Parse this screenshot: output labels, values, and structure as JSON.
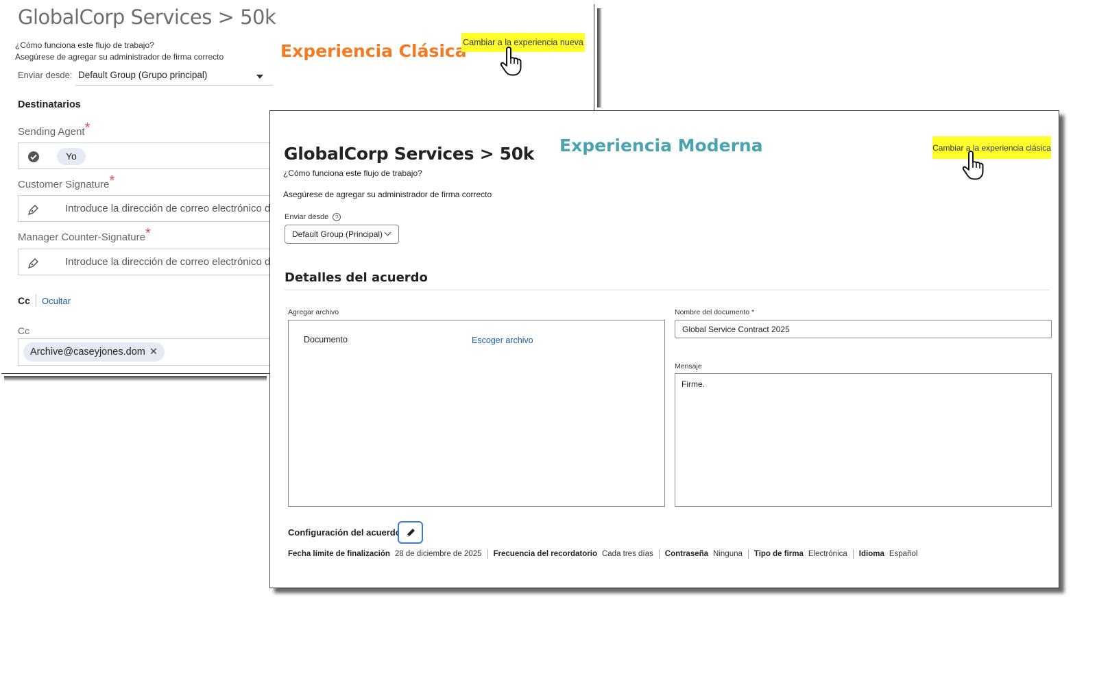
{
  "classic": {
    "title": "GlobalCorp Services > 50k",
    "how_it_works": "¿Cómo funciona este flujo de trabajo?",
    "ensure_admin": "Asegúrese de agregar su administrador de firma correcto",
    "experience_label": "Experiencia Clásica",
    "switch_button": "Cambiar a la experiencia nueva",
    "send_from_label": "Enviar desde:",
    "send_from_value": "Default Group (Grupo principal)",
    "recipients_heading": "Destinatarios",
    "recipients": [
      {
        "label": "Sending Agent",
        "required": "*",
        "value": "Yo"
      },
      {
        "label": "Customer Signature",
        "required": "*",
        "placeholder": "Introduce la dirección de correo electrónico de"
      },
      {
        "label": "Manager Counter-Signature",
        "required": "*",
        "placeholder": "Introduce la dirección de correo electrónico de"
      }
    ],
    "cc_label": "Cc",
    "hide_link": "Ocultar",
    "cc_field_label": "Cc",
    "cc_chip": "Archive@caseyjones.dom",
    "cc_chip_remove": "✕"
  },
  "modern": {
    "title": "GlobalCorp Services > 50k",
    "experience_label": "Experiencia Moderna",
    "switch_button": "Cambiar a la experiencia clásica",
    "how_it_works": "¿Cómo funciona este flujo de trabajo?",
    "ensure_admin": "Asegúrese de agregar su administrador de firma correcto",
    "send_from_label": "Enviar desde",
    "help_glyph": "?",
    "send_from_value": "Default Group (Principal)",
    "section_title": "Detalles del acuerdo",
    "add_file_label": "Agregar archivo",
    "document_label": "Documento",
    "choose_file": "Escoger archivo",
    "doc_name_label": "Nombre del documento",
    "doc_name_required": "*",
    "doc_name_value": "Global Service Contract 2025",
    "message_label": "Mensaje",
    "message_value": "Firme.",
    "config_label": "Configuración del acuerdo",
    "summary": [
      {
        "key": "Fecha límite de finalización",
        "value": "28 de diciembre de 2025"
      },
      {
        "key": "Frecuencia del recordatorio",
        "value": "Cada tres días"
      },
      {
        "key": "Contraseña",
        "value": "Ninguna"
      },
      {
        "key": "Tipo de firma",
        "value": "Electrónica"
      },
      {
        "key": "Idioma",
        "value": "Español"
      }
    ]
  },
  "colors": {
    "classic_label": "#f47a20",
    "modern_label": "#4aa3b0",
    "highlight": "#ffff2b",
    "link": "#1a5ea8",
    "required": "#e34850"
  },
  "icons": [
    "check-circle-icon",
    "pen-icon",
    "pen-icon",
    "pencil-icon",
    "hand-cursor-icon",
    "hand-cursor-icon",
    "chevron-down-icon",
    "caret-down-icon",
    "help-icon",
    "close-icon"
  ]
}
